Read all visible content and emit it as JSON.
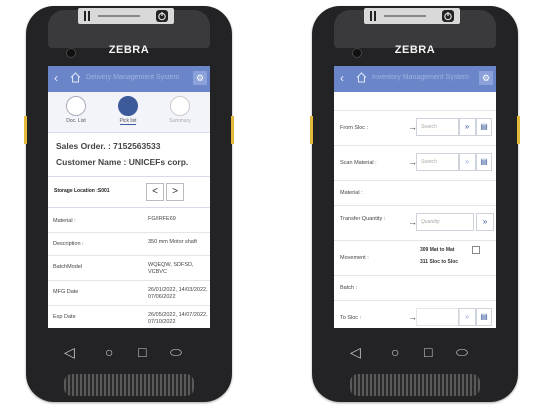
{
  "device": {
    "brand": "ZEBRA"
  },
  "left_screen": {
    "app_title": "Delivery Management System",
    "tabs": [
      {
        "label": "Doc. List"
      },
      {
        "label": "Pick list"
      },
      {
        "label": "Summary"
      }
    ],
    "sales_order": "Sales Order. : 7152563533",
    "customer_name": "Customer Name : UNICEFs corp.",
    "storage_location": "Storage Location :S001",
    "rows": [
      {
        "label": "Material :",
        "value": "FG/IRFE69"
      },
      {
        "label": "Description :",
        "value": "350 mm Motor shaft"
      },
      {
        "label": "BatchModel",
        "value": "WQEQW, SDFSD, VCBVC"
      },
      {
        "label": "MFG Date",
        "value": "26/01/2022, 14/03/2022, 07/06/2022"
      },
      {
        "label": "Exp Date",
        "value": "26/05/2022, 14/07/2022, 07/10/2022"
      }
    ]
  },
  "right_screen": {
    "app_title": "Inventory Management System",
    "rows": {
      "from_sloc": {
        "label": "From Sloc :",
        "placeholder": "Search"
      },
      "scan_material": {
        "label": "Scan Material :",
        "placeholder": "Search"
      },
      "material": {
        "label": "Material :"
      },
      "transfer_quantity": {
        "label": "Transfer Quantity :",
        "placeholder": "Quantity"
      },
      "movement": {
        "label": "Movement :",
        "option1": "309 Mat to Mat",
        "option2": "311 Sloc to Sloc"
      },
      "batch": {
        "label": "Batch :"
      },
      "to_sloc": {
        "label": "To Sloc :"
      }
    }
  },
  "icons": {
    "arrow": "→",
    "search": "»",
    "back": "‹",
    "prev": "<",
    "next": ">"
  },
  "colors": {
    "header": "#6b86c8",
    "accent": "#3d5a9b",
    "side_button": "#e2b93b"
  }
}
